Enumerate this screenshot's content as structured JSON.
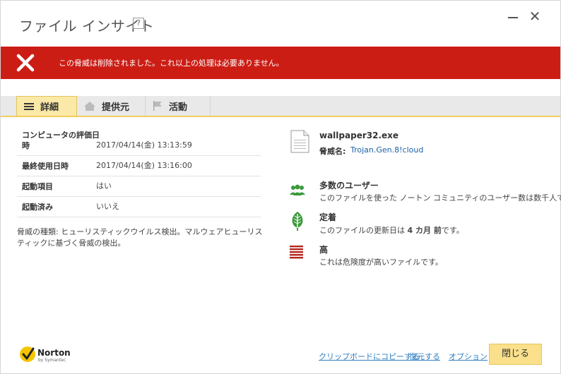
{
  "window": {
    "title": "ファイル インサイト",
    "help": "?",
    "close_glyph": "✕"
  },
  "banner": {
    "message": "この脅威は削除されました。これ以上の処理は必要ありません。",
    "color": "#cc1d15"
  },
  "tabs": [
    {
      "label": "詳細",
      "icon": "menu-lines-icon",
      "active": true
    },
    {
      "label": "提供元",
      "icon": "home-icon",
      "active": false
    },
    {
      "label": "活動",
      "icon": "flag-icon",
      "active": false
    }
  ],
  "details": [
    {
      "key": "コンピュータの評価日時",
      "value": "2017/04/14(金) 13:13:59"
    },
    {
      "key": "最終使用日時",
      "value": "2017/04/14(金) 13:16:00"
    },
    {
      "key": "起動項目",
      "value": "はい"
    },
    {
      "key": "起動済み",
      "value": "いいえ"
    }
  ],
  "threat_type": "脅威の種類: ヒューリスティックウイルス検出。マルウェアヒューリスティックに基づく脅威の検出。",
  "file": {
    "name": "wallpaper32.exe",
    "threat_label": "脅威名:",
    "threat_value": "Trojan.Gen.8!cloud"
  },
  "stats": [
    {
      "icon": "users-icon",
      "title": "多数のユーザー",
      "desc": "このファイルを使った ノートン コミュニティのユーザー数は数千人です。"
    },
    {
      "icon": "leaf-icon",
      "title": "定着",
      "desc_pre": "このファイルの更新日は ",
      "desc_bold": "4 カ月 前",
      "desc_post": "です。"
    },
    {
      "icon": "risk-bars-icon",
      "title": "高",
      "desc": "これは危険度が高いファイルです。"
    }
  ],
  "footer": {
    "logo_name": "Norton",
    "logo_sub": "by Symantec",
    "links": [
      "クリップボードにコピーする",
      "復元する",
      "オプション"
    ],
    "close_label": "閉じる"
  },
  "colors": {
    "accent": "#fbe08b",
    "link": "#2f7fc1",
    "icon_green": "#3a9a3a",
    "icon_red": "#b3261e"
  }
}
